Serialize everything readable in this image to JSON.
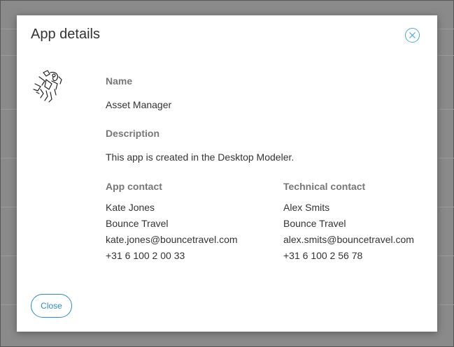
{
  "modal": {
    "title": "App details",
    "close_icon": "close-circle-icon",
    "logo_icon": "app-sketch-logo-icon",
    "accent_color": "#2a8cc4",
    "name_label": "Name",
    "name_value": "Asset Manager",
    "description_label": "Description",
    "description_value": "This app is created in the Desktop Modeler.",
    "app_contact": {
      "label": "App contact",
      "name": "Kate Jones",
      "company": "Bounce Travel",
      "email": "kate.jones@bouncetravel.com",
      "phone": "+31 6 100 2 00 33"
    },
    "technical_contact": {
      "label": "Technical contact",
      "name": "Alex Smits",
      "company": "Bounce Travel",
      "email": "alex.smits@bouncetravel.com",
      "phone": "+31 6 100 2 56 78"
    },
    "close_button_label": "Close"
  }
}
